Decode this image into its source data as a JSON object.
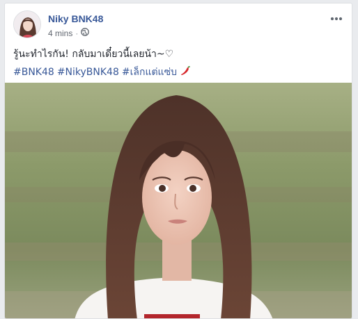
{
  "post": {
    "author": "Niky BNK48",
    "time": "4 mins",
    "separator": "·",
    "text": "รู้นะทำไรกัน! กลับมาเดี๋ยวนี้เลยน้า~♡",
    "hashtags": [
      "#BNK48",
      "#NikyBNK48",
      "#เล็กแต่แซ่บ"
    ],
    "emoji": "chili-pepper-icon"
  },
  "colors": {
    "link": "#385898",
    "meta": "#616770",
    "text": "#1d2129",
    "background": "#e9ebee"
  }
}
